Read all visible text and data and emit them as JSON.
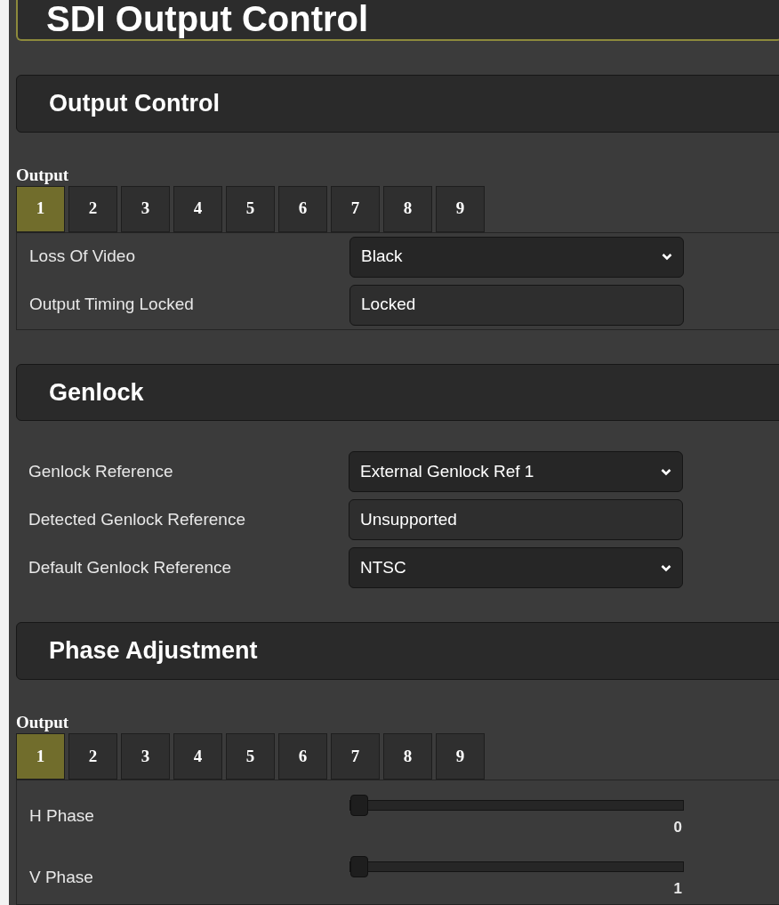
{
  "page_title": "SDI Output Control",
  "sections": [
    {
      "title": "Output Control",
      "tab_group": {
        "label": "Output",
        "tabs": [
          {
            "label": "1",
            "selected": true
          },
          {
            "label": "2",
            "selected": false
          },
          {
            "label": "3",
            "selected": false
          },
          {
            "label": "4",
            "selected": false
          },
          {
            "label": "5",
            "selected": false
          },
          {
            "label": "6",
            "selected": false
          },
          {
            "label": "7",
            "selected": false
          },
          {
            "label": "8",
            "selected": false
          },
          {
            "label": "9",
            "selected": false
          }
        ]
      },
      "rows": [
        {
          "kind": "select",
          "label": "Loss Of Video",
          "value": "Black"
        },
        {
          "kind": "readout",
          "label": "Output Timing Locked",
          "value": "Locked"
        }
      ]
    },
    {
      "title": "Genlock",
      "rows": [
        {
          "kind": "select",
          "label": "Genlock Reference",
          "value": "External Genlock Ref 1"
        },
        {
          "kind": "readout",
          "label": "Detected Genlock Reference",
          "value": "Unsupported"
        },
        {
          "kind": "select",
          "label": "Default Genlock Reference",
          "value": "NTSC"
        }
      ]
    },
    {
      "title": "Phase Adjustment",
      "tab_group": {
        "label": "Output",
        "tabs": [
          {
            "label": "1",
            "selected": true
          },
          {
            "label": "2",
            "selected": false
          },
          {
            "label": "3",
            "selected": false
          },
          {
            "label": "4",
            "selected": false
          },
          {
            "label": "5",
            "selected": false
          },
          {
            "label": "6",
            "selected": false
          },
          {
            "label": "7",
            "selected": false
          },
          {
            "label": "8",
            "selected": false
          },
          {
            "label": "9",
            "selected": false
          }
        ]
      },
      "rows": [
        {
          "kind": "slider",
          "label": "H Phase",
          "level": 0,
          "reading": "0"
        },
        {
          "kind": "slider",
          "label": "V Phase",
          "level": 0,
          "reading": "1"
        }
      ]
    }
  ]
}
